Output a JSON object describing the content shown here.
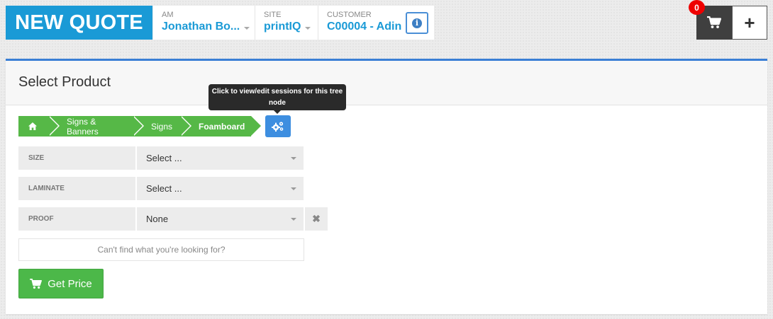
{
  "header": {
    "title": "NEW QUOTE",
    "am": {
      "label": "AM",
      "value": "Jonathan Bo..."
    },
    "site": {
      "label": "SITE",
      "value": "printIQ"
    },
    "customer": {
      "label": "CUSTOMER",
      "value": "C00004 - Adin"
    },
    "info_icon": "info-icon",
    "cart_count": "0",
    "add_label": "+"
  },
  "panel": {
    "title": "Select Product",
    "tooltip": "Click to view/edit sessions for this tree node",
    "breadcrumb": [
      "Signs & Banners",
      "Signs",
      "Foamboard"
    ],
    "fields": [
      {
        "label": "SIZE",
        "value": "Select ..."
      },
      {
        "label": "LAMINATE",
        "value": "Select ..."
      },
      {
        "label": "PROOF",
        "value": "None"
      }
    ],
    "cant_find": "Can't find what you're looking for?",
    "get_price": "Get Price"
  },
  "colors": {
    "brand_blue": "#1a9ad6",
    "accent_blue": "#3a7fd5",
    "breadcrumb_green": "#56b847",
    "button_green": "#4cb849",
    "badge_red": "#ee0000",
    "dark": "#3f3f3f"
  }
}
